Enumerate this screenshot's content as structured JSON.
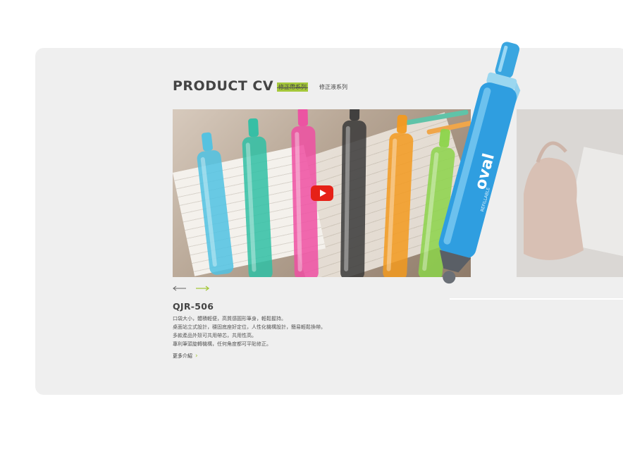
{
  "section": {
    "title": "PRODUCT CV",
    "tabs": [
      {
        "label": "修正帶系列",
        "active": true
      },
      {
        "label": "修正液系列",
        "active": false
      }
    ]
  },
  "video": {
    "play_icon": "youtube-play-icon",
    "pen_colors": [
      "#4fc2e3",
      "#2fbfa4",
      "#ee4fa2",
      "#3a3a3a",
      "#f39a1f",
      "#8cd44a"
    ]
  },
  "carousel": {
    "prev_icon": "arrow-left-icon",
    "next_icon": "arrow-right-icon",
    "accent": "#a5c83a"
  },
  "product": {
    "model": "QJR-506",
    "description": [
      "口袋大小，體積輕便，高質感圓形筆身，輕鬆握持。",
      "桌面站立式設計，穩固底座好定位，人性化機構設計，簡易輕鬆換帶。",
      "多款產品外殼可共用帶芯，共用性高。",
      "專利筆頭旋轉機構，任何角度都可平貼修正。"
    ],
    "more_label": "更多介紹",
    "more_icon": "chevron-right-icon"
  }
}
